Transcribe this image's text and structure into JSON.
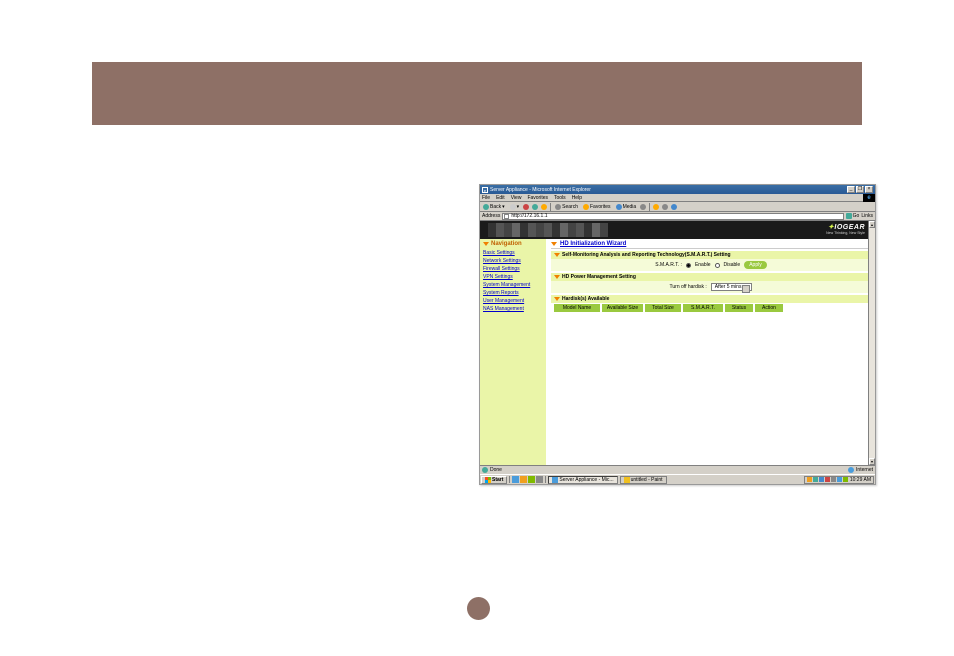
{
  "titlebar": {
    "title": "Server Appliance - Microsoft Internet Explorer"
  },
  "menubar": {
    "items": [
      "File",
      "Edit",
      "View",
      "Favorites",
      "Tools",
      "Help"
    ]
  },
  "toolbar": {
    "back": "Back",
    "search": "Search",
    "favorites": "Favorites",
    "media": "Media"
  },
  "addressbar": {
    "label": "Address",
    "value": "http://172.16.1.1",
    "go": "Go",
    "links": "Links"
  },
  "banner": {
    "brand_prefix": "I",
    "brand_main": "OGEAR",
    "tagline": "New Thinking, New Style"
  },
  "nav": {
    "header": "Navigation",
    "items": [
      "Basic Settings",
      "Network Settings",
      "Firewall Settings",
      "VPN Settings",
      "System Management",
      "System Reports",
      "User Management",
      "NAS Management"
    ]
  },
  "page": {
    "title": "HD Initialization Wizard",
    "sections": {
      "smart": {
        "heading": "Self-Monitoring Analysis and Reporting Technology(S.M.A.R.T.) Setting",
        "label": "S.M.A.R.T. :",
        "enable": "Enable",
        "disable": "Disable",
        "apply": "Apply"
      },
      "power": {
        "heading": "HD Power Management Setting",
        "label": "Turn off hardisk :",
        "value": "After 5 mins"
      },
      "available": {
        "heading": "Hardisk(s) Available",
        "columns": [
          "Model Name",
          "Available Size",
          "Total Size",
          "S.M.A.R.T.",
          "Status",
          "Action"
        ]
      }
    }
  },
  "statusbar": {
    "left": "Done",
    "right": "Internet"
  },
  "taskbar": {
    "start": "Start",
    "tasks": [
      "Server Appliance - Mic...",
      "untitled - Paint"
    ],
    "clock": "10:29 AM"
  }
}
